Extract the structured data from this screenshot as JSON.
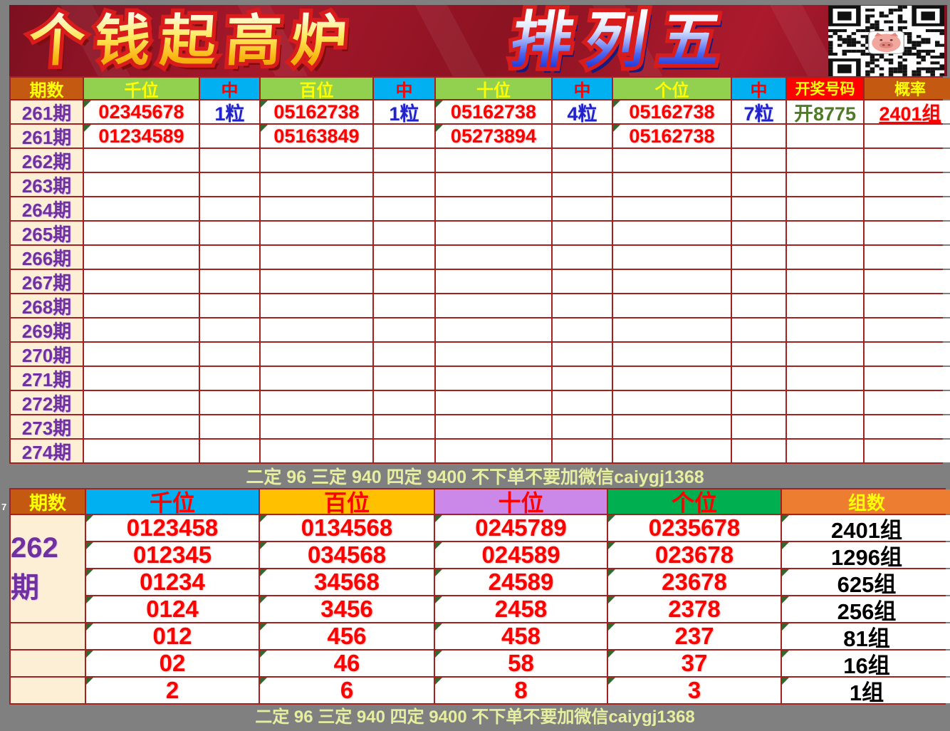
{
  "banner": {
    "title_left": "个钱起高炉",
    "title_right": "排列五",
    "qr_label": "wechat-qr-code"
  },
  "excel": {
    "row_number": "7"
  },
  "table1": {
    "headers": [
      "期数",
      "千位",
      "中",
      "百位",
      "中",
      "十位",
      "中",
      "个位",
      "中",
      "开奖号码",
      "概率"
    ],
    "rows": [
      {
        "period": "261期",
        "qian": "02345678",
        "qian_hit": "1粒",
        "bai": "05162738",
        "bai_hit": "1粒",
        "shi": "05162738",
        "shi_hit": "4粒",
        "ge": "05162738",
        "ge_hit": "7粒",
        "draw": "开8775",
        "prob": "2401组"
      },
      {
        "period": "261期",
        "qian": "01234589",
        "qian_hit": "",
        "bai": "05163849",
        "bai_hit": "",
        "shi": "05273894",
        "shi_hit": "",
        "ge": "05162738",
        "ge_hit": "",
        "draw": "",
        "prob": ""
      },
      {
        "period": "262期"
      },
      {
        "period": "263期"
      },
      {
        "period": "264期"
      },
      {
        "period": "265期"
      },
      {
        "period": "266期"
      },
      {
        "period": "267期"
      },
      {
        "period": "268期"
      },
      {
        "period": "269期"
      },
      {
        "period": "270期"
      },
      {
        "period": "271期"
      },
      {
        "period": "272期"
      },
      {
        "period": "273期"
      },
      {
        "period": "274期"
      }
    ]
  },
  "notice": {
    "text": "二定 96 三定 940 四定 9400 不下单不要加微信caiygj1368"
  },
  "table2": {
    "headers": [
      "期数",
      "千位",
      "百位",
      "十位",
      "个位",
      "组数"
    ],
    "period": "262期",
    "rows": [
      [
        "0123458",
        "0134568",
        "0245789",
        "0235678",
        "2401组"
      ],
      [
        "012345",
        "034568",
        "024589",
        "023678",
        "1296组"
      ],
      [
        "01234",
        "34568",
        "24589",
        "23678",
        "625组"
      ],
      [
        "0124",
        "3456",
        "2458",
        "2378",
        "256组"
      ],
      [
        "012",
        "456",
        "458",
        "237",
        "81组"
      ],
      [
        "02",
        "46",
        "58",
        "37",
        "16组"
      ],
      [
        "2",
        "6",
        "8",
        "3",
        "1组"
      ]
    ]
  },
  "footer": {
    "text": "二定 96 三定 940 四定 9400 不下单不要加微信caiygj1368"
  }
}
